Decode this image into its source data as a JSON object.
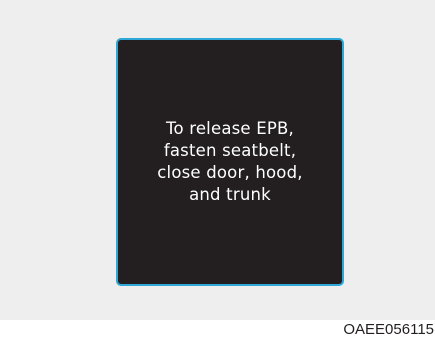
{
  "display": {
    "message_lines": [
      "To release EPB,",
      "fasten seatbelt,",
      "close door, hood,",
      "and trunk"
    ]
  },
  "figure_code": "OAEE056115",
  "colors": {
    "panel_background": "#eeeeee",
    "screen_background": "#231f20",
    "screen_border": "#2ea7d6",
    "message_text": "#ffffff"
  }
}
